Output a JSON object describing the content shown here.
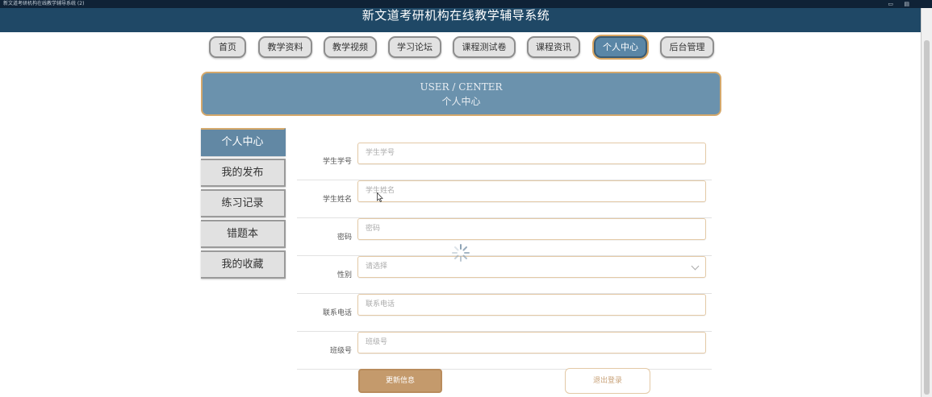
{
  "window": {
    "title": "新文道考研机构在线教学辅导系统 (2)"
  },
  "header": {
    "site_title": "新文道考研机构在线教学辅导系统"
  },
  "nav": {
    "items": [
      {
        "label": "首页"
      },
      {
        "label": "教学资料"
      },
      {
        "label": "教学视频"
      },
      {
        "label": "学习论坛"
      },
      {
        "label": "课程测试卷"
      },
      {
        "label": "课程资讯"
      },
      {
        "label": "个人中心",
        "active": true
      },
      {
        "label": "后台管理"
      }
    ]
  },
  "banner": {
    "title_en": "USER / CENTER",
    "title_zh": "个人中心"
  },
  "sidebar": {
    "items": [
      {
        "label": "个人中心",
        "active": true
      },
      {
        "label": "我的发布"
      },
      {
        "label": "练习记录"
      },
      {
        "label": "错题本"
      },
      {
        "label": "我的收藏"
      }
    ]
  },
  "form": {
    "fields": [
      {
        "label": "学生学号",
        "placeholder": "学生学号"
      },
      {
        "label": "学生姓名",
        "placeholder": "学生姓名"
      },
      {
        "label": "密码",
        "placeholder": "密码"
      },
      {
        "label": "性别",
        "placeholder": "请选择"
      },
      {
        "label": "联系电话",
        "placeholder": "联系电话"
      },
      {
        "label": "班级号",
        "placeholder": "班级号"
      }
    ],
    "update_label": "更新信息",
    "logout_label": "退出登录"
  },
  "icons": {
    "loading": "loading-spinner-icon",
    "cursor": "mouse-cursor-icon",
    "select": "chevron-down-icon"
  },
  "colors": {
    "header": "#1f4866",
    "accent": "#6b92ad",
    "gold": "#d4a86b",
    "button": "#c49a6c"
  }
}
